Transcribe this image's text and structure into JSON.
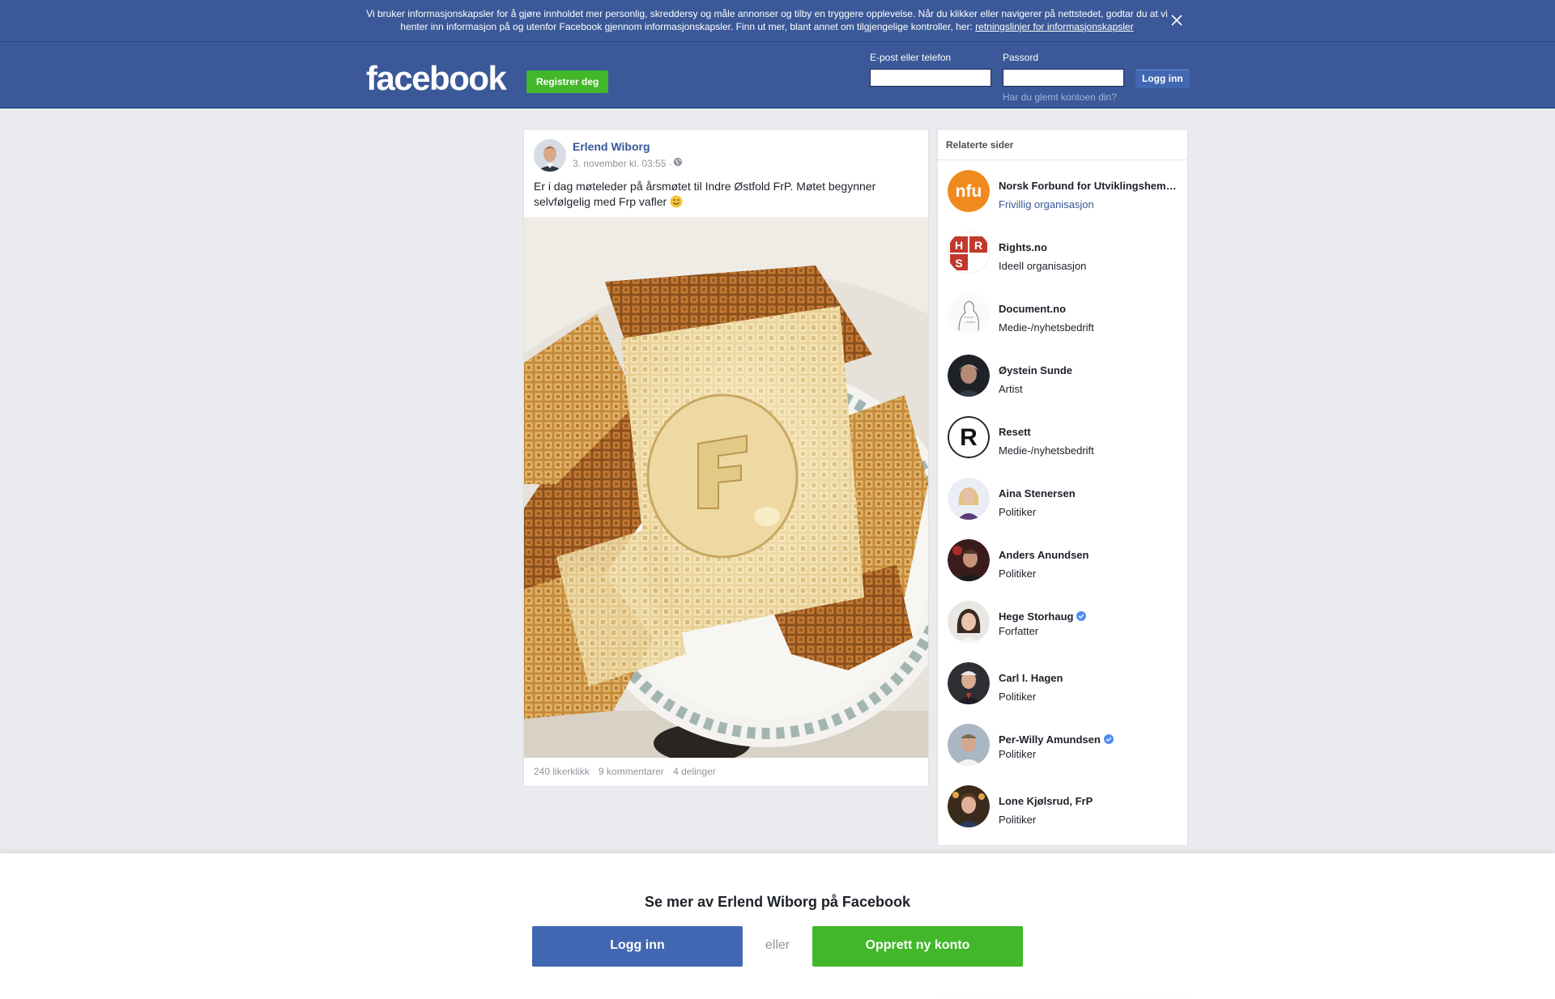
{
  "cookie": {
    "text": "Vi bruker informasjonskapsler for å gjøre innholdet mer personlig, skreddersy og måle annonser og tilby en tryggere opplevelse. Når du klikker eller navigerer på nettstedet, godtar du at vi henter inn informasjon på og utenfor Facebook gjennom informasjonskapsler. Finn ut mer, blant annet om tilgjengelige kontroller, her: ",
    "link": "retningslinjer for informasjonskapsler",
    "close_icon": "close-icon"
  },
  "header": {
    "logo": "facebook",
    "register_label": "Registrer deg",
    "email_label": "E-post eller telefon",
    "email_value": "",
    "password_label": "Passord",
    "password_value": "",
    "login_label": "Logg inn",
    "forgot_label": "Har du glemt kontoen din?"
  },
  "post": {
    "author": "Erlend Wiborg",
    "time": "3. november kl. 03:55 ·",
    "text": "Er i dag møteleder på årsmøtet til Indre Østfold FrP. Møtet begynner selvfølgelig med Frp vafler ",
    "likes": "240 likerklikk",
    "comments": "9 kommentarer",
    "shares": "4 delinger"
  },
  "related": {
    "title": "Relaterte sider",
    "items": [
      {
        "name": "Norsk Forbund for Utviklingshemmede",
        "category": "Frivillig organisasjon",
        "verified": false
      },
      {
        "name": "Rights.no",
        "category": "Ideell organisasjon",
        "verified": false
      },
      {
        "name": "Document.no",
        "category": "Medie-/nyhetsbedrift",
        "verified": false
      },
      {
        "name": "Øystein Sunde",
        "category": "Artist",
        "verified": false
      },
      {
        "name": "Resett",
        "category": "Medie-/nyhetsbedrift",
        "verified": false
      },
      {
        "name": "Aina Stenersen",
        "category": "Politiker",
        "verified": false
      },
      {
        "name": "Anders Anundsen",
        "category": "Politiker",
        "verified": false
      },
      {
        "name": "Hege Storhaug",
        "category": "Forfatter",
        "verified": true
      },
      {
        "name": "Carl I. Hagen",
        "category": "Politiker",
        "verified": false
      },
      {
        "name": "Per-Willy Amundsen",
        "category": "Politiker",
        "verified": true
      },
      {
        "name": "Lone Kjølsrud, FrP",
        "category": "Politiker",
        "verified": false
      }
    ]
  },
  "bottom": {
    "title": "Se mer av Erlend Wiborg på Facebook",
    "login_label": "Logg inn",
    "or_label": "eller",
    "create_label": "Opprett ny konto"
  },
  "colors": {
    "brand_blue": "#3b5998",
    "button_blue": "#4267b2",
    "green": "#42b72a",
    "link": "#365899"
  }
}
